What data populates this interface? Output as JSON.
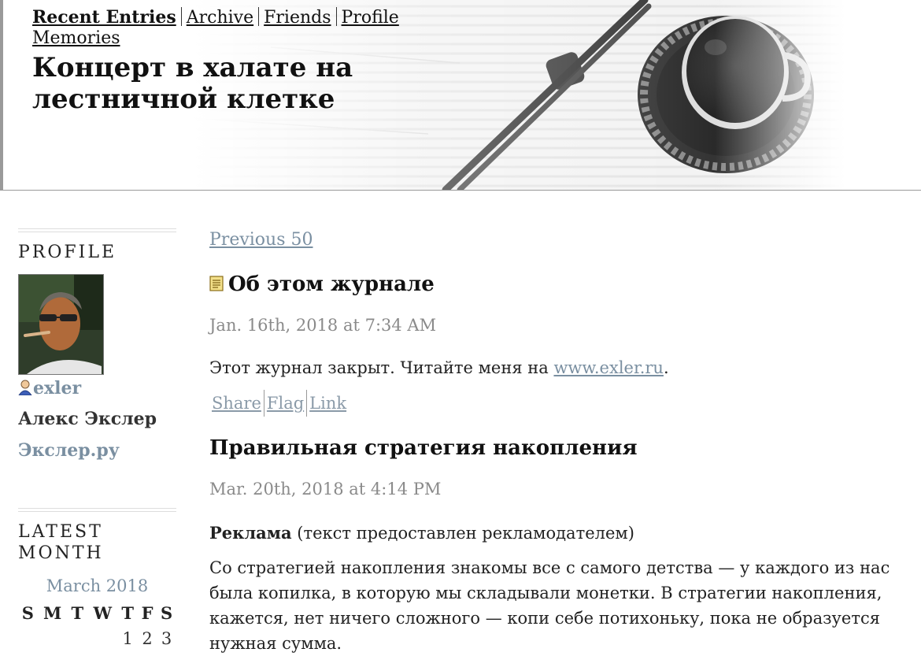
{
  "nav": {
    "recent": "Recent Entries",
    "archive": "Archive",
    "friends": "Friends",
    "profile": "Profile",
    "memories": "Memories"
  },
  "site_title": "Концерт в халате на лестничной клетке",
  "sidebar": {
    "profile_heading": "PROFILE",
    "username": "exler",
    "full_name": "Алекс Экслер",
    "website": "Экслер.ру",
    "latest_month_heading_1": "LATEST",
    "latest_month_heading_2": "MONTH",
    "calendar": {
      "title": "March 2018",
      "weekdays": [
        "S",
        "M",
        "T",
        "W",
        "T",
        "F",
        "S"
      ],
      "first_row": [
        "",
        "",
        "",
        "",
        "1",
        "2",
        "3"
      ]
    }
  },
  "main": {
    "previous_link": "Previous 50",
    "entries": [
      {
        "title": "Об этом журнале",
        "date": "Jan. 16th, 2018 at 7:34 AM",
        "body_text": "Этот журнал закрыт. Читайте меня на ",
        "body_link": "www.exler.ru",
        "body_end": ".",
        "actions": [
          "Share",
          "Flag",
          "Link"
        ]
      },
      {
        "title": "Правильная стратегия накопления",
        "date": "Mar. 20th, 2018 at 4:14 PM",
        "ad_label": "Реклама",
        "ad_note": " (текст предоставлен рекламодателем)",
        "para": "Со стратегией накопления знакомы все с самого детства — у каждого из  нас была копилка, в которую мы складывали монетки. В стратегии  накопления, кажется, нет ничего сложного — копи себе потихоньку, пока не  образуется нужная сумма."
      }
    ]
  }
}
